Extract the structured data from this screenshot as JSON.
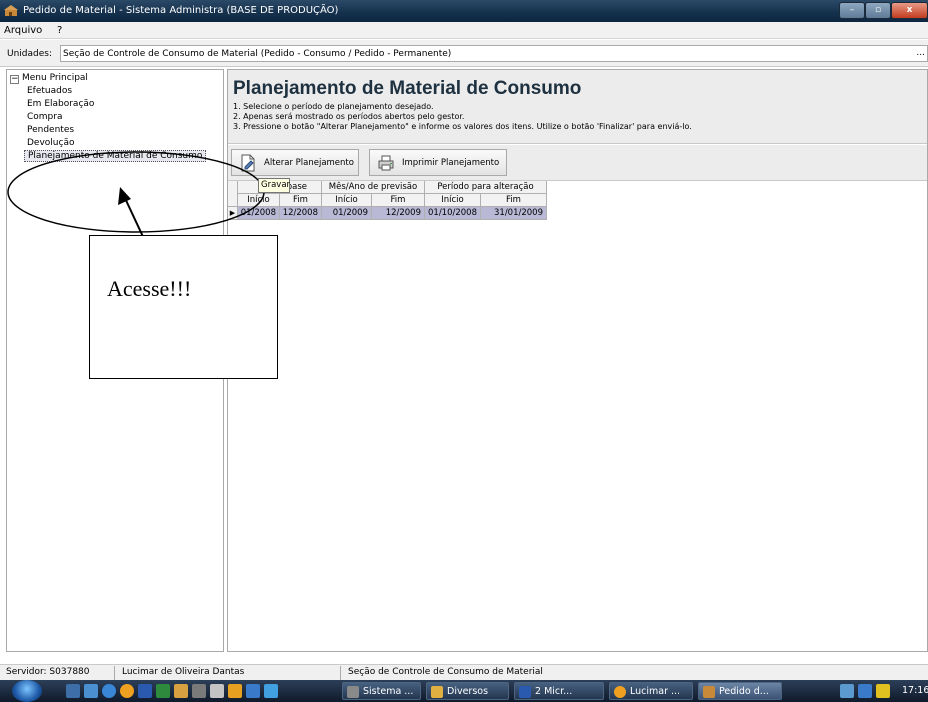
{
  "window": {
    "title": "Pedido de Material - Sistema Administra (BASE DE PRODUÇÃO)",
    "minimize": "–",
    "maximize": "▫",
    "close": "x"
  },
  "menu": {
    "items": [
      "Arquivo",
      "?"
    ]
  },
  "units": {
    "label": "Unidades:",
    "value": "Seção de Controle de Consumo de Material (Pedido - Consumo / Pedido - Permanente)",
    "more": "..."
  },
  "tree": {
    "expander": "−",
    "root": "Menu Principal",
    "items": [
      "Efetuados",
      "Em Elaboração",
      "Compra",
      "Pendentes",
      "Devolução",
      "Planejamento de Material de Consumo"
    ],
    "selected_index": 5
  },
  "header": {
    "title": "Planejamento de Material de Consumo",
    "instructions": [
      "1. Selecione o período de planejamento desejado.",
      "2. Apenas será mostrado os períodos abertos pelo gestor.",
      "3. Pressione o botão \"Alterar Planejamento\" e informe os valores dos itens. Utilize o botão 'Finalizar' para enviá-lo."
    ]
  },
  "toolbar": {
    "alterar": "Alterar Planejamento",
    "imprimir": "Imprimir Planejamento",
    "tooltip": "Gravar"
  },
  "grid": {
    "groups": [
      "Mês/Ano de base",
      "Mês/Ano de previsão",
      "Período para alteração"
    ],
    "group_visible_base": "o de base",
    "subheaders": [
      "Início",
      "Fim",
      "Início",
      "Fim",
      "Início",
      "Fim"
    ],
    "rows": [
      [
        "01/2008",
        "12/2008",
        "01/2009",
        "12/2009",
        "01/10/2008",
        "31/01/2009"
      ]
    ],
    "row_indicator": "▶"
  },
  "annotation": {
    "callout": "Acesse!!!"
  },
  "status": {
    "server": "Servidor: S037880",
    "user": "Lucimar de Oliveira Dantas",
    "unit": "Seção de Controle de Consumo de Material"
  },
  "taskbar": {
    "tasks": [
      "Sistema ...",
      "Diversos",
      "2 Micr...",
      "Lucimar ...",
      "Pedido d..."
    ],
    "clock": "17:16"
  },
  "colors": {
    "accent": "#16324e",
    "selected_row": "#b9b9d6",
    "header_bg": "#ececec"
  }
}
